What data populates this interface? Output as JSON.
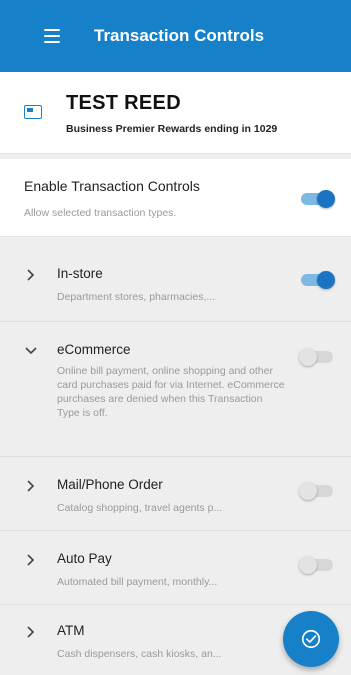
{
  "appbar": {
    "title": "Transaction Controls"
  },
  "account": {
    "name": "TEST REED",
    "subtitle": "Business Premier Rewards ending in 1029"
  },
  "enable": {
    "title": "Enable Transaction Controls",
    "subtitle": "Allow selected transaction types.",
    "enabled": true
  },
  "transaction_types": [
    {
      "title": "In-store",
      "subtitle": "Department stores, pharmacies,...",
      "enabled": true,
      "expanded": false
    },
    {
      "title": "eCommerce",
      "subtitle": "Online bill payment, online shopping and other card purchases paid for via Internet. eCommerce purchases are denied when this Transaction Type is off.",
      "enabled": false,
      "expanded": true
    },
    {
      "title": "Mail/Phone Order",
      "subtitle": "Catalog shopping, travel agents p...",
      "enabled": false,
      "expanded": false
    },
    {
      "title": "Auto Pay",
      "subtitle": "Automated bill payment, monthly...",
      "enabled": false,
      "expanded": false
    },
    {
      "title": "ATM",
      "subtitle": "Cash dispensers, cash kiosks, an...",
      "enabled": false,
      "expanded": false
    }
  ],
  "colors": {
    "primary": "#1681c8",
    "toggle_on": "#1a73c4",
    "background": "#eeeeee"
  },
  "icons": {
    "menu": "menu-icon",
    "card": "card-icon",
    "fab": "check-icon",
    "chevron_collapsed": "chevron-right-icon",
    "chevron_expanded": "chevron-down-icon"
  }
}
